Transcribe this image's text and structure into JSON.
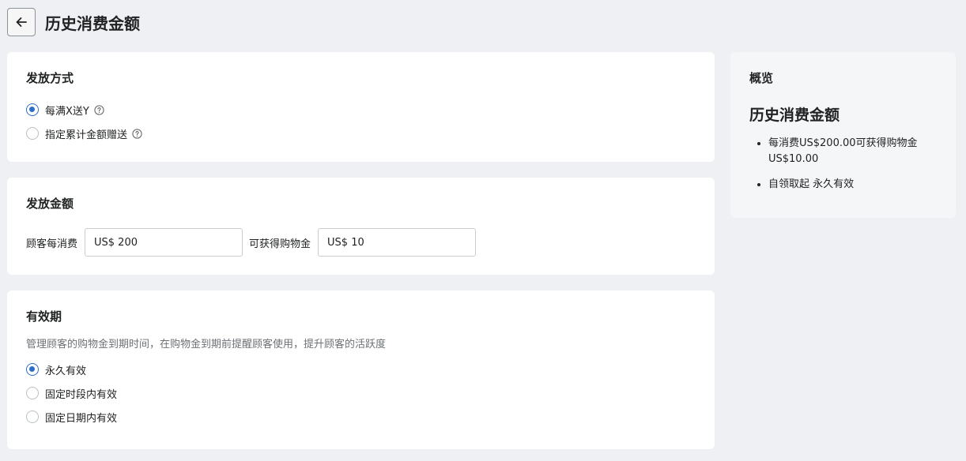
{
  "header": {
    "back_icon": "arrow-left-icon",
    "title": "历史消费金额"
  },
  "method": {
    "title": "发放方式",
    "options": [
      {
        "label": "每满X送Y",
        "checked": true,
        "help_icon": "question-circle-icon"
      },
      {
        "label": "指定累计金额赠送",
        "checked": false,
        "help_icon": "question-circle-icon"
      }
    ]
  },
  "amount": {
    "title": "发放金额",
    "spend_label": "顾客每消费",
    "spend_value": "US$ 200",
    "get_label": "可获得购物金",
    "get_value": "US$ 10"
  },
  "validity": {
    "title": "有效期",
    "description": "管理顾客的购物金到期时间，在购物金到期前提醒顾客使用，提升顾客的活跃度",
    "options": [
      {
        "label": "永久有效",
        "checked": true
      },
      {
        "label": "固定时段内有效",
        "checked": false
      },
      {
        "label": "固定日期内有效",
        "checked": false
      }
    ]
  },
  "overview": {
    "title": "概览",
    "heading": "历史消费金额",
    "items": [
      "每消费US$200.00可获得购物金US$10.00",
      "自领取起 永久有效"
    ]
  },
  "colors": {
    "accent": "#2c6ecb",
    "background": "#eef0f3",
    "card": "#ffffff",
    "overview_card": "#f4f6f8"
  }
}
